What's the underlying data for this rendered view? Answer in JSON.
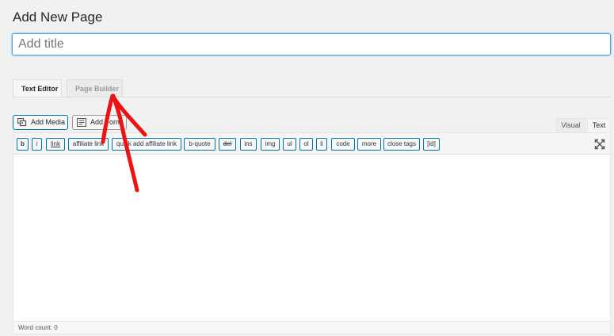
{
  "page": {
    "title": "Add New Page",
    "title_placeholder": "Add title"
  },
  "builder_tabs": {
    "text_editor": "Text Editor",
    "page_builder": "Page Builder"
  },
  "media_buttons": {
    "add_media": "Add Media",
    "add_form": "Add Form"
  },
  "editor_modes": {
    "visual": "Visual",
    "text": "Text"
  },
  "quicktags": [
    "b",
    "i",
    "link",
    "affiliate link",
    "quick add affiliate link",
    "b-quote",
    "del",
    "ins",
    "img",
    "ul",
    "ol",
    "li",
    "code",
    "more",
    "close tags",
    "[id]"
  ],
  "status": {
    "word_count": "Word count: 0"
  },
  "annotation": {
    "arrow_color": "#ee1111"
  },
  "colors": {
    "accent": "#0073aa",
    "focus": "#5b9dd9",
    "background": "#f1f1f1"
  }
}
